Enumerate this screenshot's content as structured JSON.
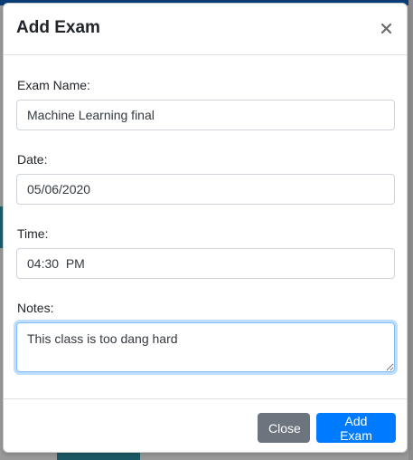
{
  "modal": {
    "title": "Add Exam",
    "close_icon": "close-x-icon"
  },
  "form": {
    "exam_name": {
      "label": "Exam Name:",
      "value": "Machine Learning final"
    },
    "date": {
      "label": "Date:",
      "value": "05/06/2020"
    },
    "time": {
      "label": "Time:",
      "value": "04:30  PM"
    },
    "notes": {
      "label": "Notes:",
      "value": "This class is too dang hard"
    }
  },
  "footer": {
    "close_label": "Close",
    "add_label": "Add Exam"
  },
  "colors": {
    "primary": "#007bff",
    "secondary": "#6c757d",
    "focus_border": "#80bdff"
  }
}
